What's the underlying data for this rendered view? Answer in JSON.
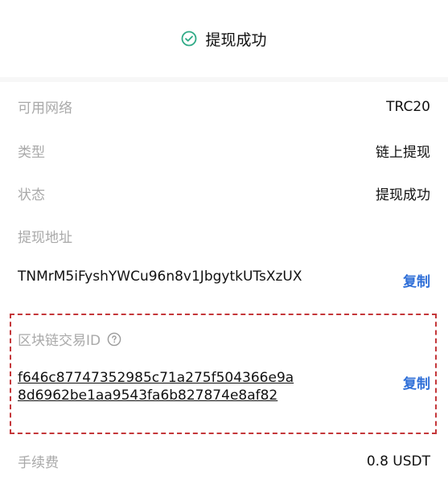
{
  "header": {
    "status_icon": "check-circle-icon",
    "status_text": "提现成功",
    "accent_color": "#2faa86"
  },
  "details": {
    "network_label": "可用网络",
    "network_value": "TRC20",
    "type_label": "类型",
    "type_value": "链上提现",
    "status_label": "状态",
    "status_value": "提现成功",
    "address_label": "提现地址",
    "address_value": "TNMrM5iFyshYWCu96n8v1JbgytkUTsXzUX",
    "address_copy": "复制",
    "txid_label": "区块链交易ID",
    "txid_help_icon": "question-circle-icon",
    "txid_value": "f646c87747352985c71a275f504366e9a8d6962be1aa9543fa6b827874e8af82",
    "txid_copy": "复制",
    "fee_label": "手续费",
    "fee_value": "0.8 USDT"
  },
  "colors": {
    "link": "#2f6fd8",
    "highlight_border": "#c4373a",
    "muted_text": "#a9a9a9"
  }
}
